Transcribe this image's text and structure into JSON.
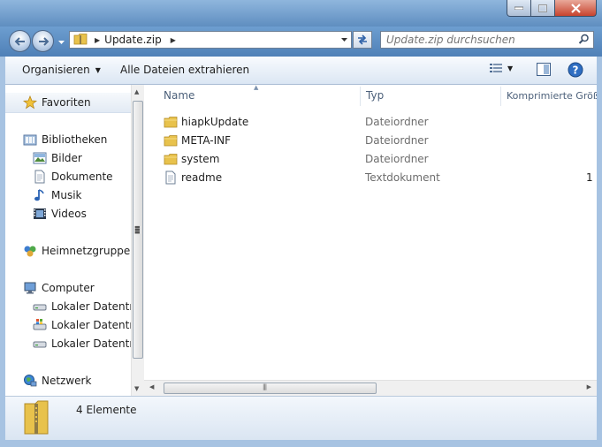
{
  "address": {
    "crumb": "Update.zip"
  },
  "search": {
    "placeholder": "Update.zip durchsuchen"
  },
  "toolbar": {
    "organize_label": "Organisieren",
    "extract_label": "Alle Dateien extrahieren"
  },
  "nav": {
    "favorites": "Favoriten",
    "libraries": "Bibliotheken",
    "library_items": [
      "Bilder",
      "Dokumente",
      "Musik",
      "Videos"
    ],
    "homegroup": "Heimnetzgruppe",
    "computer": "Computer",
    "drives": [
      "Lokaler Datenträger",
      "Lokaler Datenträger",
      "Lokaler Datenträger"
    ],
    "network": "Netzwerk"
  },
  "columns": {
    "name": "Name",
    "type": "Typ",
    "compressed": "Komprimierte Größe"
  },
  "files": [
    {
      "name": "hiapkUpdate",
      "type": "Dateiordner",
      "size": "",
      "icon": "folder-icon"
    },
    {
      "name": "META-INF",
      "type": "Dateiordner",
      "size": "",
      "icon": "folder-icon"
    },
    {
      "name": "system",
      "type": "Dateiordner",
      "size": "",
      "icon": "folder-icon"
    },
    {
      "name": "readme",
      "type": "Textdokument",
      "size": "1",
      "icon": "text-document-icon"
    }
  ],
  "status": {
    "count_text": "4 Elemente"
  },
  "colors": {
    "title_gradient_top": "#8fb6dd",
    "address_bar": "#5f8ec0",
    "folder_yellow": "#e8c24c",
    "close_red": "#c7432e"
  }
}
